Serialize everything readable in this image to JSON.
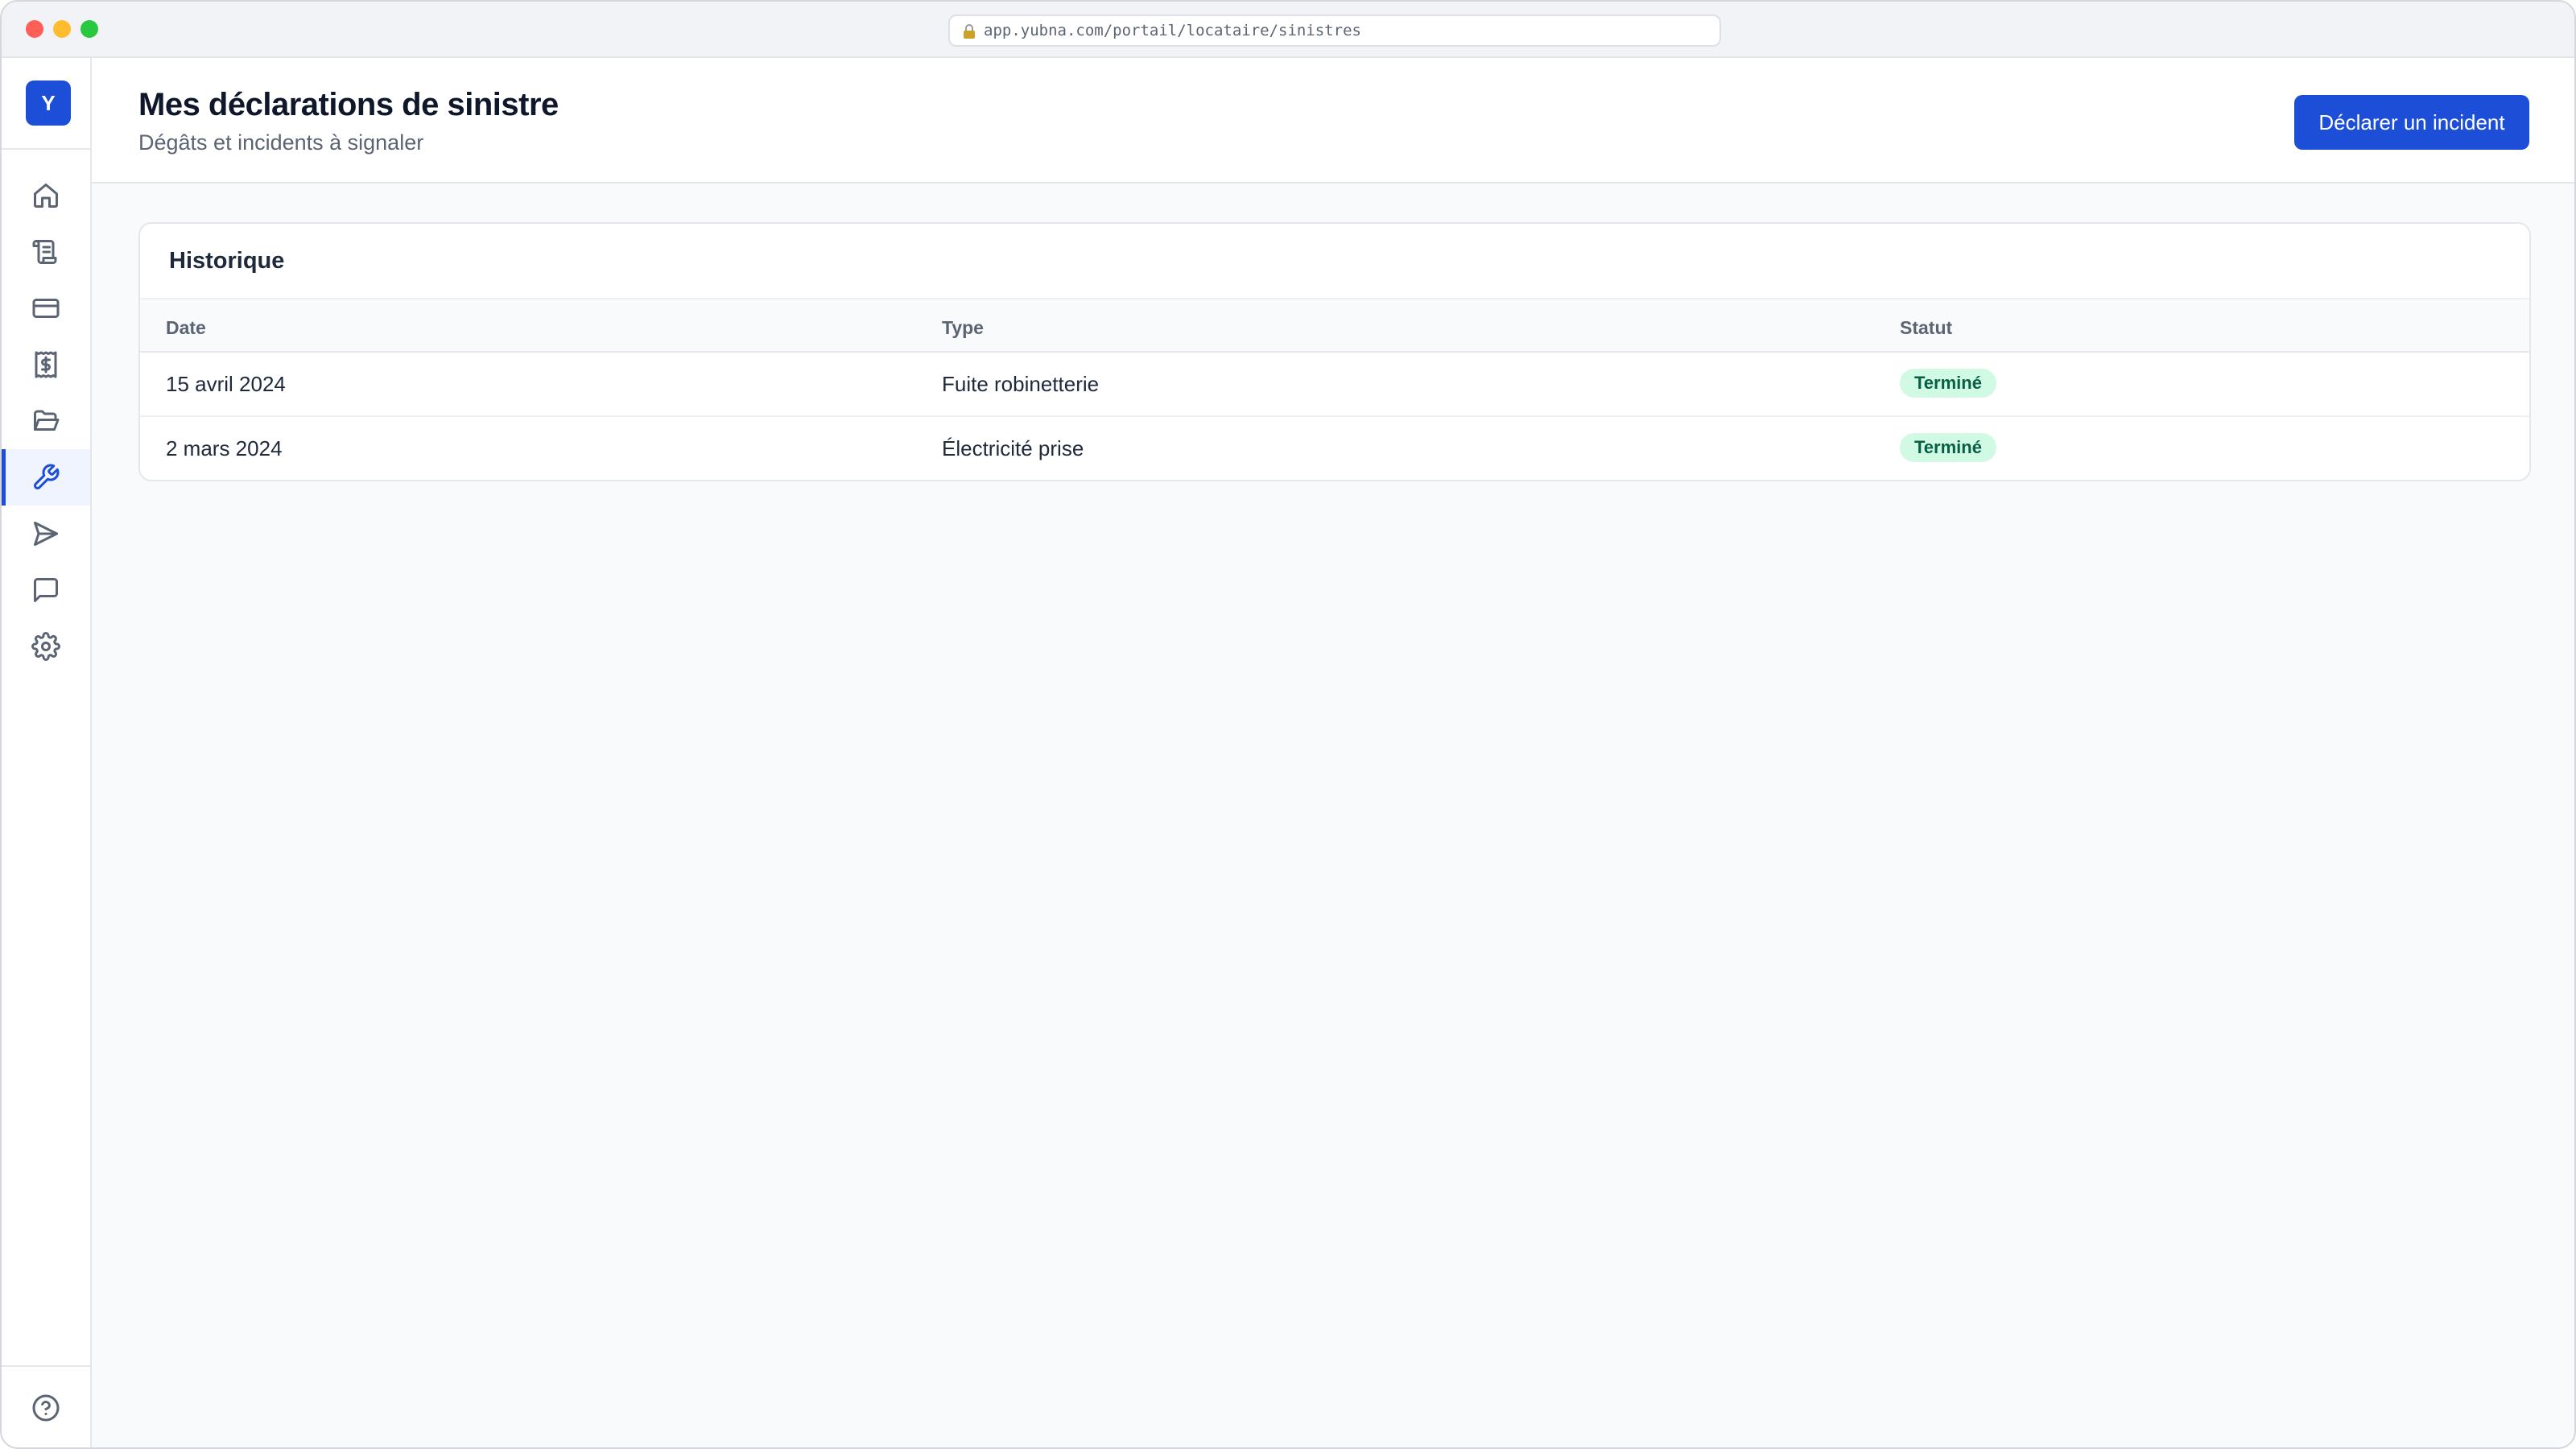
{
  "browser": {
    "url": "app.yubna.com/portail/locataire/sinistres"
  },
  "sidebar": {
    "logo_letter": "Y",
    "items": [
      {
        "name": "home-icon",
        "active": false
      },
      {
        "name": "lease-scroll-icon",
        "active": false
      },
      {
        "name": "credit-card-icon",
        "active": false
      },
      {
        "name": "receipt-icon",
        "active": false
      },
      {
        "name": "folder-icon",
        "active": false
      },
      {
        "name": "wrench-icon",
        "active": true
      },
      {
        "name": "send-icon",
        "active": false
      },
      {
        "name": "message-icon",
        "active": false
      },
      {
        "name": "settings-icon",
        "active": false
      }
    ],
    "help_icon": "help-circle-icon"
  },
  "header": {
    "title": "Mes déclarations de sinistre",
    "subtitle": "Dégâts et incidents à signaler",
    "primary_action": "Déclarer un incident"
  },
  "history": {
    "title": "Historique",
    "columns": [
      "Date",
      "Type",
      "Statut"
    ],
    "rows": [
      {
        "date": "15 avril 2024",
        "type": "Fuite robinetterie",
        "status": "Terminé"
      },
      {
        "date": "2 mars 2024",
        "type": "Électricité prise",
        "status": "Terminé"
      }
    ]
  },
  "colors": {
    "accent": "#1d4ed8",
    "status_done_bg": "#d1fae5",
    "status_done_text": "#065f46"
  }
}
